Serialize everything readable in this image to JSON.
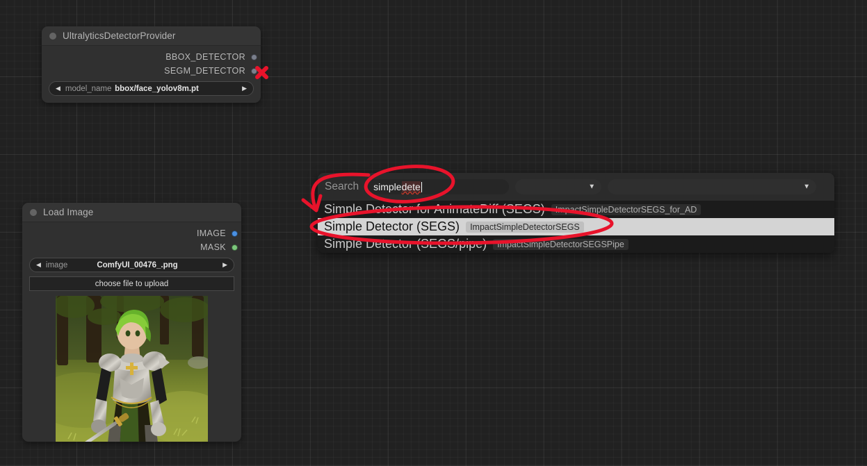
{
  "app": {
    "name": "ComfyUI node graph canvas"
  },
  "nodes": [
    {
      "id": "ultralytics",
      "title": "UltralyticsDetectorProvider",
      "outputs": [
        {
          "label": "BBOX_DETECTOR",
          "color": "#7a7f8c"
        },
        {
          "label": "SEGM_DETECTOR",
          "color": "#7a7f8c"
        }
      ],
      "widgets": [
        {
          "name": "model_name",
          "value": "bbox/face_yolov8m.pt",
          "left_arrow": "◀",
          "right_arrow": "▶"
        }
      ]
    },
    {
      "id": "load-image",
      "title": "Load Image",
      "outputs": [
        {
          "label": "IMAGE",
          "color": "#4a90e2"
        },
        {
          "label": "MASK",
          "color": "#7cc77c"
        }
      ],
      "widgets": [
        {
          "name": "image",
          "value": "ComfyUI_00476_.png",
          "left_arrow": "◀",
          "right_arrow": "▶"
        }
      ],
      "button": "choose file to upload",
      "preview_alt": "anime knight with green hair holding a sword in a sunlit forest"
    }
  ],
  "search_panel": {
    "label": "Search",
    "query": "simple dete",
    "query_plain": "simple ",
    "query_misspelled": "dete",
    "placeholder": "",
    "filters": [
      {
        "name": "category-filter",
        "value": "",
        "options": [
          ""
        ]
      },
      {
        "name": "type-filter",
        "value": "",
        "options": [
          ""
        ]
      }
    ],
    "results": [
      {
        "title": "Simple Detector for AnimateDiff (SEGS)",
        "id": "ImpactSimpleDetectorSEGS_for_AD",
        "selected": false
      },
      {
        "title": "Simple Detector (SEGS)",
        "id": "ImpactSimpleDetectorSEGS",
        "selected": true
      },
      {
        "title": "Simple Detector (SEGS/pipe)",
        "id": "ImpactSimpleDetectorSEGSPipe",
        "selected": false
      }
    ]
  },
  "annotations": {
    "color": "#e8132b",
    "marks": [
      {
        "name": "red-x-over-segm-detector-port",
        "type": "x-cross"
      },
      {
        "name": "red-arrow-to-search-label",
        "type": "arrow"
      },
      {
        "name": "red-ellipse-around-query",
        "type": "ellipse"
      },
      {
        "name": "red-ellipse-around-selected-result",
        "type": "ellipse"
      }
    ]
  },
  "colors": {
    "canvas_bg": "#212121",
    "node_body": "#303030",
    "node_header": "#353535",
    "panel_bg": "#2b2b2b",
    "result_bg": "#1b1b1b",
    "highlight": "#d4d4d4",
    "annotation_red": "#e8132b"
  }
}
